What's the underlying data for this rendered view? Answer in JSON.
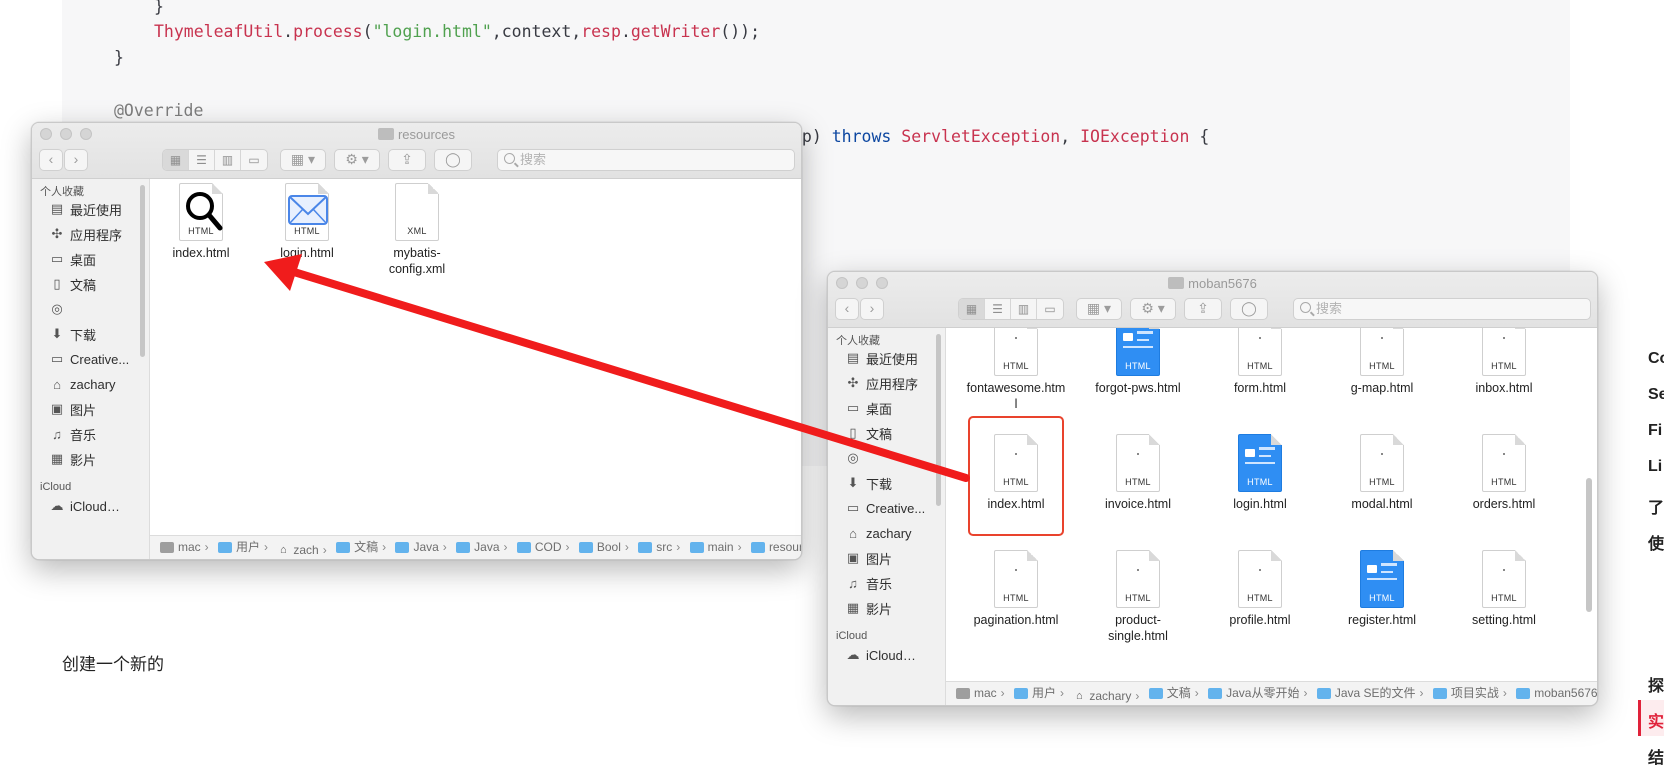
{
  "code": {
    "brace1": "}",
    "process_cls": "ThymeleafUtil",
    "process_dot": ".",
    "process_method": "process",
    "process_open": "(",
    "process_str": "\"login.html\"",
    "process_mid": ",context,",
    "process_resp": "resp",
    "process_dot2": ".",
    "process_getwriter": "getWriter",
    "process_end": "());",
    "brace2": "}",
    "annotation": "@Override",
    "sig_tail_a": "sp) ",
    "sig_throws": "throws ",
    "sig_ex1": "ServletException",
    "sig_comma": ", ",
    "sig_ex2": "IOException",
    "sig_brace": " {"
  },
  "doc_text": "创建一个新的",
  "toc": [
    "Co",
    "Se",
    "Fi",
    "Li",
    "了",
    "使",
    "探",
    "实",
    "结"
  ],
  "accent_color": "#e0223a",
  "window_left": {
    "title": "resources",
    "search_placeholder": "搜索",
    "sidebar_favorites_header": "个人收藏",
    "sidebar_items": [
      {
        "label": "最近使用",
        "icon": "clock-icon",
        "glyph": "▤"
      },
      {
        "label": "应用程序",
        "icon": "applications-icon",
        "glyph": "✣"
      },
      {
        "label": "桌面",
        "icon": "desktop-icon",
        "glyph": "▭"
      },
      {
        "label": "文稿",
        "icon": "documents-icon",
        "glyph": "▯"
      },
      {
        "label": "",
        "icon": "airdrop-icon",
        "glyph": "◎"
      },
      {
        "label": "下载",
        "icon": "downloads-icon",
        "glyph": "⬇"
      },
      {
        "label": "Creative...",
        "icon": "folder-icon",
        "glyph": "▭"
      },
      {
        "label": "zachary",
        "icon": "home-icon",
        "glyph": "⌂"
      },
      {
        "label": "图片",
        "icon": "camera-icon",
        "glyph": "▣"
      },
      {
        "label": "音乐",
        "icon": "music-icon",
        "glyph": "♫"
      },
      {
        "label": "影片",
        "icon": "film-icon",
        "glyph": "▦"
      }
    ],
    "sidebar_icloud_header": "iCloud",
    "sidebar_icloud_item": "iCloud…",
    "files": [
      {
        "name": "index.html",
        "ext": "HTML",
        "icon": "magnifier-html-icon"
      },
      {
        "name": "login.html",
        "ext": "HTML",
        "icon": "mail-html-icon"
      },
      {
        "name": "mybatis-config.xml",
        "name_l1": "mybatis-",
        "name_l2": "config.xml",
        "ext": "XML",
        "icon": "xml-file-icon"
      }
    ],
    "path": [
      "mac",
      "用户",
      "zach",
      "文稿",
      "Java",
      "Java",
      "COD",
      "Bool",
      "src",
      "main",
      "resources"
    ]
  },
  "window_right": {
    "title": "moban5676",
    "search_placeholder": "搜索",
    "sidebar_favorites_header": "个人收藏",
    "sidebar_items": [
      {
        "label": "最近使用",
        "icon": "clock-icon",
        "glyph": "▤"
      },
      {
        "label": "应用程序",
        "icon": "applications-icon",
        "glyph": "✣"
      },
      {
        "label": "桌面",
        "icon": "desktop-icon",
        "glyph": "▭"
      },
      {
        "label": "文稿",
        "icon": "documents-icon",
        "glyph": "▯"
      },
      {
        "label": "",
        "icon": "airdrop-icon",
        "glyph": "◎"
      },
      {
        "label": "下载",
        "icon": "downloads-icon",
        "glyph": "⬇"
      },
      {
        "label": "Creative...",
        "icon": "folder-icon",
        "glyph": "▭"
      },
      {
        "label": "zachary",
        "icon": "home-icon",
        "glyph": "⌂"
      },
      {
        "label": "图片",
        "icon": "camera-icon",
        "glyph": "▣"
      },
      {
        "label": "音乐",
        "icon": "music-icon",
        "glyph": "♫"
      },
      {
        "label": "影片",
        "icon": "film-icon",
        "glyph": "▦"
      }
    ],
    "sidebar_icloud_header": "iCloud",
    "sidebar_icloud_item": "iCloud…",
    "files_row1": [
      {
        "name_l1": "fontawesome.htm",
        "name_l2": "l",
        "ext": "HTML",
        "blue": false
      },
      {
        "name_l1": "forgot-pws.html",
        "name_l2": "",
        "ext": "HTML",
        "blue": true
      },
      {
        "name_l1": "form.html",
        "name_l2": "",
        "ext": "HTML",
        "blue": false
      },
      {
        "name_l1": "g-map.html",
        "name_l2": "",
        "ext": "HTML",
        "blue": false
      },
      {
        "name_l1": "inbox.html",
        "name_l2": "",
        "ext": "HTML",
        "blue": false
      }
    ],
    "files_row2": [
      {
        "name_l1": "index.html",
        "name_l2": "",
        "ext": "HTML",
        "blue": false
      },
      {
        "name_l1": "invoice.html",
        "name_l2": "",
        "ext": "HTML",
        "blue": false
      },
      {
        "name_l1": "login.html",
        "name_l2": "",
        "ext": "HTML",
        "blue": true
      },
      {
        "name_l1": "modal.html",
        "name_l2": "",
        "ext": "HTML",
        "blue": false
      },
      {
        "name_l1": "orders.html",
        "name_l2": "",
        "ext": "HTML",
        "blue": false
      }
    ],
    "files_row3": [
      {
        "name_l1": "pagination.html",
        "name_l2": "",
        "ext": "HTML",
        "blue": false
      },
      {
        "name_l1": "product-",
        "name_l2": "single.html",
        "ext": "HTML",
        "blue": false
      },
      {
        "name_l1": "profile.html",
        "name_l2": "",
        "ext": "HTML",
        "blue": false
      },
      {
        "name_l1": "register.html",
        "name_l2": "",
        "ext": "HTML",
        "blue": true
      },
      {
        "name_l1": "setting.html",
        "name_l2": "",
        "ext": "HTML",
        "blue": false
      }
    ],
    "path": [
      "mac",
      "用户",
      "zachary",
      "文稿",
      "Java从零开始",
      "Java SE的文件",
      "项目实战",
      "moban5676"
    ]
  },
  "highlight_color": "#e9432d",
  "arrow_color": "#f01c1c"
}
